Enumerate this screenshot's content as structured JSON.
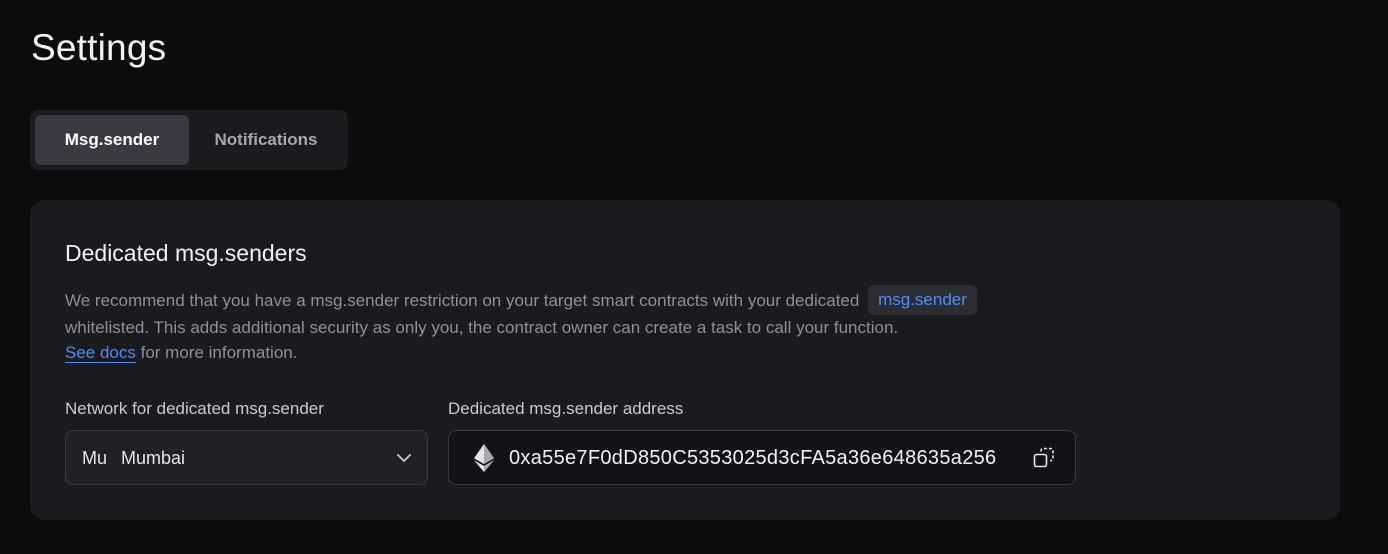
{
  "page": {
    "title": "Settings"
  },
  "tabs": [
    {
      "label": "Msg.sender",
      "active": true
    },
    {
      "label": "Notifications",
      "active": false
    }
  ],
  "card": {
    "title": "Dedicated msg.senders",
    "description_part1": "We recommend that you have a msg.sender restriction on your target smart contracts with your dedicated",
    "code_pill": "msg.sender",
    "description_part2": "whitelisted. This adds additional security as only you, the contract owner can create a task to call your function.",
    "docs_link": "See docs",
    "docs_suffix": " for more information."
  },
  "network_field": {
    "label": "Network for dedicated msg.sender",
    "abbr": "Mu",
    "value": "Mumbai",
    "icon": "chevron-down-icon"
  },
  "address_field": {
    "label": "Dedicated msg.sender address",
    "value": "0xa55e7F0dD850C5353025d3cFA5a36e648635a256",
    "network_icon": "ethereum-icon",
    "copy_icon": "copy-icon"
  },
  "colors": {
    "background": "#0c0c0c",
    "card": "#1a1b1f",
    "accent": "#4e8bf7",
    "active_tab": "#3a3b42",
    "muted_text": "#8e9099"
  }
}
